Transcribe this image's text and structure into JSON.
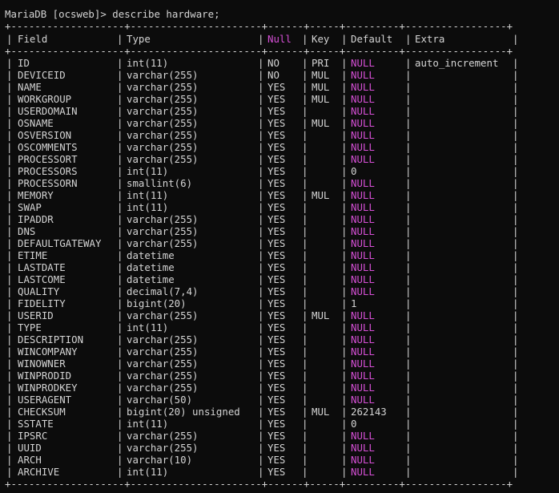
{
  "prompt": "MariaDB [ocsweb]> describe hardware;",
  "border": "+-------------------+----------------------+------+-----+---------+-----------------+",
  "columns": [
    "Field",
    "Type",
    "Null",
    "Key",
    "Default",
    "Extra"
  ],
  "rows": [
    {
      "field": "ID",
      "type": "int(11)",
      "null": "NO",
      "key": "PRI",
      "default": "NULL",
      "extra": "auto_increment"
    },
    {
      "field": "DEVICEID",
      "type": "varchar(255)",
      "null": "NO",
      "key": "MUL",
      "default": "NULL",
      "extra": ""
    },
    {
      "field": "NAME",
      "type": "varchar(255)",
      "null": "YES",
      "key": "MUL",
      "default": "NULL",
      "extra": ""
    },
    {
      "field": "WORKGROUP",
      "type": "varchar(255)",
      "null": "YES",
      "key": "MUL",
      "default": "NULL",
      "extra": ""
    },
    {
      "field": "USERDOMAIN",
      "type": "varchar(255)",
      "null": "YES",
      "key": "",
      "default": "NULL",
      "extra": ""
    },
    {
      "field": "OSNAME",
      "type": "varchar(255)",
      "null": "YES",
      "key": "MUL",
      "default": "NULL",
      "extra": ""
    },
    {
      "field": "OSVERSION",
      "type": "varchar(255)",
      "null": "YES",
      "key": "",
      "default": "NULL",
      "extra": ""
    },
    {
      "field": "OSCOMMENTS",
      "type": "varchar(255)",
      "null": "YES",
      "key": "",
      "default": "NULL",
      "extra": ""
    },
    {
      "field": "PROCESSORT",
      "type": "varchar(255)",
      "null": "YES",
      "key": "",
      "default": "NULL",
      "extra": ""
    },
    {
      "field": "PROCESSORS",
      "type": "int(11)",
      "null": "YES",
      "key": "",
      "default": "0",
      "extra": ""
    },
    {
      "field": "PROCESSORN",
      "type": "smallint(6)",
      "null": "YES",
      "key": "",
      "default": "NULL",
      "extra": ""
    },
    {
      "field": "MEMORY",
      "type": "int(11)",
      "null": "YES",
      "key": "MUL",
      "default": "NULL",
      "extra": ""
    },
    {
      "field": "SWAP",
      "type": "int(11)",
      "null": "YES",
      "key": "",
      "default": "NULL",
      "extra": ""
    },
    {
      "field": "IPADDR",
      "type": "varchar(255)",
      "null": "YES",
      "key": "",
      "default": "NULL",
      "extra": ""
    },
    {
      "field": "DNS",
      "type": "varchar(255)",
      "null": "YES",
      "key": "",
      "default": "NULL",
      "extra": ""
    },
    {
      "field": "DEFAULTGATEWAY",
      "type": "varchar(255)",
      "null": "YES",
      "key": "",
      "default": "NULL",
      "extra": ""
    },
    {
      "field": "ETIME",
      "type": "datetime",
      "null": "YES",
      "key": "",
      "default": "NULL",
      "extra": ""
    },
    {
      "field": "LASTDATE",
      "type": "datetime",
      "null": "YES",
      "key": "",
      "default": "NULL",
      "extra": ""
    },
    {
      "field": "LASTCOME",
      "type": "datetime",
      "null": "YES",
      "key": "",
      "default": "NULL",
      "extra": ""
    },
    {
      "field": "QUALITY",
      "type": "decimal(7,4)",
      "null": "YES",
      "key": "",
      "default": "NULL",
      "extra": ""
    },
    {
      "field": "FIDELITY",
      "type": "bigint(20)",
      "null": "YES",
      "key": "",
      "default": "1",
      "extra": ""
    },
    {
      "field": "USERID",
      "type": "varchar(255)",
      "null": "YES",
      "key": "MUL",
      "default": "NULL",
      "extra": ""
    },
    {
      "field": "TYPE",
      "type": "int(11)",
      "null": "YES",
      "key": "",
      "default": "NULL",
      "extra": ""
    },
    {
      "field": "DESCRIPTION",
      "type": "varchar(255)",
      "null": "YES",
      "key": "",
      "default": "NULL",
      "extra": ""
    },
    {
      "field": "WINCOMPANY",
      "type": "varchar(255)",
      "null": "YES",
      "key": "",
      "default": "NULL",
      "extra": ""
    },
    {
      "field": "WINOWNER",
      "type": "varchar(255)",
      "null": "YES",
      "key": "",
      "default": "NULL",
      "extra": ""
    },
    {
      "field": "WINPRODID",
      "type": "varchar(255)",
      "null": "YES",
      "key": "",
      "default": "NULL",
      "extra": ""
    },
    {
      "field": "WINPRODKEY",
      "type": "varchar(255)",
      "null": "YES",
      "key": "",
      "default": "NULL",
      "extra": ""
    },
    {
      "field": "USERAGENT",
      "type": "varchar(50)",
      "null": "YES",
      "key": "",
      "default": "NULL",
      "extra": ""
    },
    {
      "field": "CHECKSUM",
      "type": "bigint(20) unsigned",
      "null": "YES",
      "key": "MUL",
      "default": "262143",
      "extra": ""
    },
    {
      "field": "SSTATE",
      "type": "int(11)",
      "null": "YES",
      "key": "",
      "default": "0",
      "extra": ""
    },
    {
      "field": "IPSRC",
      "type": "varchar(255)",
      "null": "YES",
      "key": "",
      "default": "NULL",
      "extra": ""
    },
    {
      "field": "UUID",
      "type": "varchar(255)",
      "null": "YES",
      "key": "",
      "default": "NULL",
      "extra": ""
    },
    {
      "field": "ARCH",
      "type": "varchar(10)",
      "null": "YES",
      "key": "",
      "default": "NULL",
      "extra": ""
    },
    {
      "field": "ARCHIVE",
      "type": "int(11)",
      "null": "YES",
      "key": "",
      "default": "NULL",
      "extra": ""
    }
  ],
  "colors": {
    "background": "#0c0c0c",
    "text": "#d4d4d4",
    "null_highlight": "#d54fd5"
  }
}
